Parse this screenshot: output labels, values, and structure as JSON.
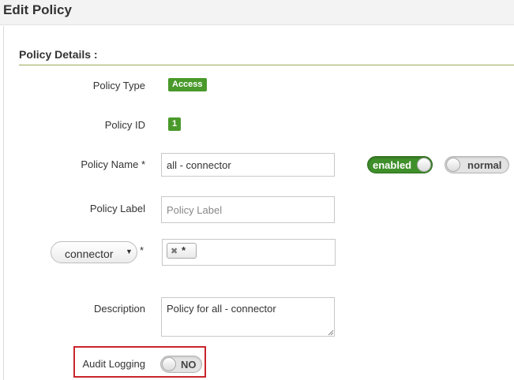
{
  "header": {
    "title": "Edit Policy"
  },
  "section": {
    "title": "Policy Details :"
  },
  "fields": {
    "policy_type": {
      "label": "Policy Type",
      "value": "Access"
    },
    "policy_id": {
      "label": "Policy ID",
      "value": "1"
    },
    "policy_name": {
      "label": "Policy Name *",
      "value": "all - connector"
    },
    "policy_label": {
      "label": "Policy Label",
      "placeholder": "Policy Label",
      "value": ""
    },
    "scope": {
      "selected": "connector",
      "required_mark": "*",
      "tags": [
        "*"
      ]
    },
    "description": {
      "label": "Description",
      "value": "Policy for all - connector"
    },
    "audit_logging": {
      "label": "Audit Logging",
      "state": "NO"
    }
  },
  "toggles": {
    "enabled": {
      "label": "enabled",
      "on": true
    },
    "priority": {
      "label": "normal",
      "on": false
    }
  },
  "icons": {
    "dropdown_caret": "▼",
    "remove_tag": "✖"
  },
  "colors": {
    "accent_green": "#4a9a2b",
    "section_rule": "#9aaa57",
    "highlight_red": "#c8252b"
  }
}
